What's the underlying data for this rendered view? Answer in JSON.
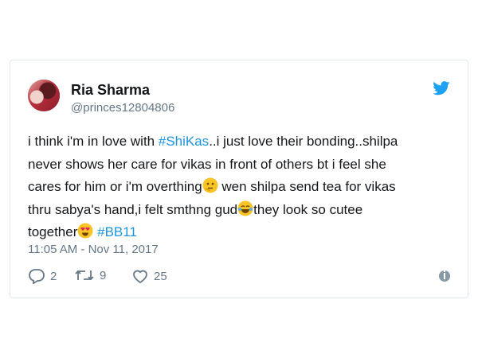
{
  "tweet": {
    "author_name": "Ria Sharma",
    "handle": "@princes12804806",
    "lines": [
      {
        "parts": [
          {
            "t": "i think i'm in love with ",
            "k": "text"
          },
          {
            "t": "#ShiKas",
            "k": "tag"
          },
          {
            "t": "..i just love their bonding..shilpa",
            "k": "text"
          }
        ]
      },
      {
        "parts": [
          {
            "t": "never shows her care for vikas in front of others bt i feel she",
            "k": "text"
          }
        ]
      },
      {
        "parts": [
          {
            "t": "cares for him or i'm overthing",
            "k": "text"
          },
          {
            "t": "thinking-face-emoji",
            "k": "emoji"
          },
          {
            "t": " wen shilpa send tea for vikas",
            "k": "text"
          }
        ]
      },
      {
        "parts": [
          {
            "t": "thru sabya's hand,i felt smthng gud",
            "k": "text"
          },
          {
            "t": "tears-of-joy-emoji",
            "k": "emoji"
          },
          {
            "t": "they look so cutee",
            "k": "text"
          }
        ]
      },
      {
        "parts": [
          {
            "t": "together",
            "k": "text"
          },
          {
            "t": "heart-eyes-emoji",
            "k": "emoji"
          },
          {
            "t": " ",
            "k": "text"
          },
          {
            "t": "#BB11",
            "k": "tag"
          }
        ]
      }
    ],
    "timestamp": "11:05 AM - Nov 11, 2017",
    "reply_count": "2",
    "retweet_count": "9",
    "like_count": "25",
    "colors": {
      "link": "#1b95e0",
      "muted": "#657786",
      "text": "#14171a",
      "twitter_blue": "#1da1f2"
    },
    "icons": [
      "twitter-bird-icon",
      "reply-icon",
      "retweet-icon",
      "like-icon",
      "info-icon"
    ]
  }
}
